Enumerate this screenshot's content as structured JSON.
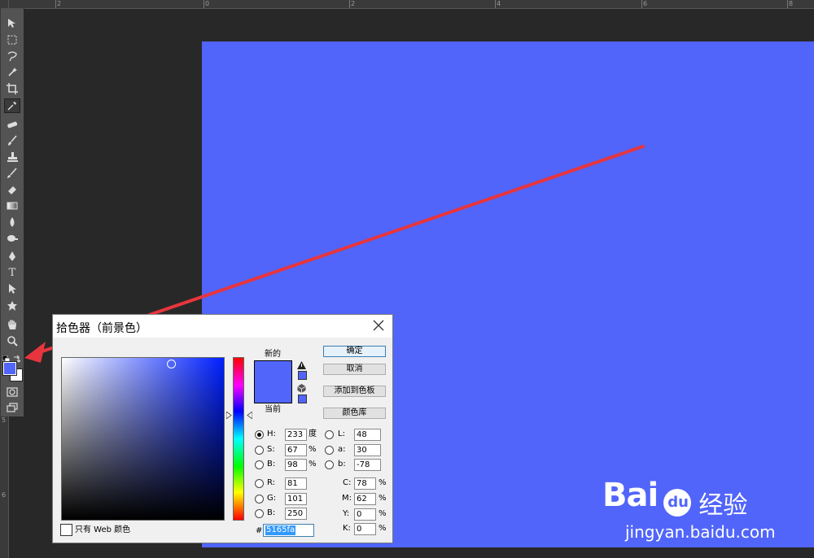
{
  "ruler": {
    "top_labels": [
      "2",
      "0",
      "2",
      "4",
      "6",
      "8",
      "10",
      "12",
      "14",
      "16"
    ],
    "left_labels": [
      "5",
      "6"
    ]
  },
  "toolbar": {
    "tools": [
      {
        "name": "move-tool-icon"
      },
      {
        "name": "marquee-tool-icon"
      },
      {
        "name": "lasso-tool-icon"
      },
      {
        "name": "magic-wand-tool-icon"
      },
      {
        "name": "crop-tool-icon"
      },
      {
        "name": "eyedropper-tool-icon",
        "active": true
      },
      {
        "name": "healing-brush-tool-icon"
      },
      {
        "name": "brush-tool-icon"
      },
      {
        "name": "clone-stamp-tool-icon"
      },
      {
        "name": "history-brush-tool-icon"
      },
      {
        "name": "eraser-tool-icon"
      },
      {
        "name": "gradient-tool-icon"
      },
      {
        "name": "blur-tool-icon"
      },
      {
        "name": "dodge-tool-icon"
      },
      {
        "name": "pen-tool-icon"
      },
      {
        "name": "type-tool-icon"
      },
      {
        "name": "path-selection-tool-icon"
      },
      {
        "name": "shape-tool-icon"
      },
      {
        "name": "hand-tool-icon"
      },
      {
        "name": "zoom-tool-icon"
      }
    ],
    "type_tool_glyph": "T"
  },
  "colors": {
    "foreground": "#5165fa",
    "background": "#ffffff",
    "canvas": "#5165fa",
    "arrow": "#e8353d"
  },
  "dialog": {
    "title": "拾色器（前景色）",
    "new_label": "新的",
    "current_label": "当前",
    "buttons": {
      "ok": "确定",
      "cancel": "取消",
      "add_to_swatches": "添加到色板",
      "color_libraries": "颜色库"
    },
    "hsb": [
      {
        "label": "H:",
        "value": "233",
        "unit": "度",
        "selected": true
      },
      {
        "label": "S:",
        "value": "67",
        "unit": "%"
      },
      {
        "label": "B:",
        "value": "98",
        "unit": "%"
      }
    ],
    "rgb": [
      {
        "label": "R:",
        "value": "81"
      },
      {
        "label": "G:",
        "value": "101"
      },
      {
        "label": "B:",
        "value": "250"
      }
    ],
    "lab": [
      {
        "label": "L:",
        "value": "48"
      },
      {
        "label": "a:",
        "value": "30"
      },
      {
        "label": "b:",
        "value": "-78"
      }
    ],
    "cmyk": [
      {
        "label": "C:",
        "value": "78",
        "unit": "%"
      },
      {
        "label": "M:",
        "value": "62",
        "unit": "%"
      },
      {
        "label": "Y:",
        "value": "0",
        "unit": "%"
      },
      {
        "label": "K:",
        "value": "0",
        "unit": "%"
      }
    ],
    "hex_label": "#",
    "hex_value": "5165fa",
    "web_only_label": "只有 Web 颜色",
    "web_only_checked": false,
    "field_hue_color": "#0020ff"
  },
  "watermark": {
    "logo_text": "Bai",
    "logo_du": "du",
    "logo_cn": "经验",
    "url": "jingyan.baidu.com"
  }
}
